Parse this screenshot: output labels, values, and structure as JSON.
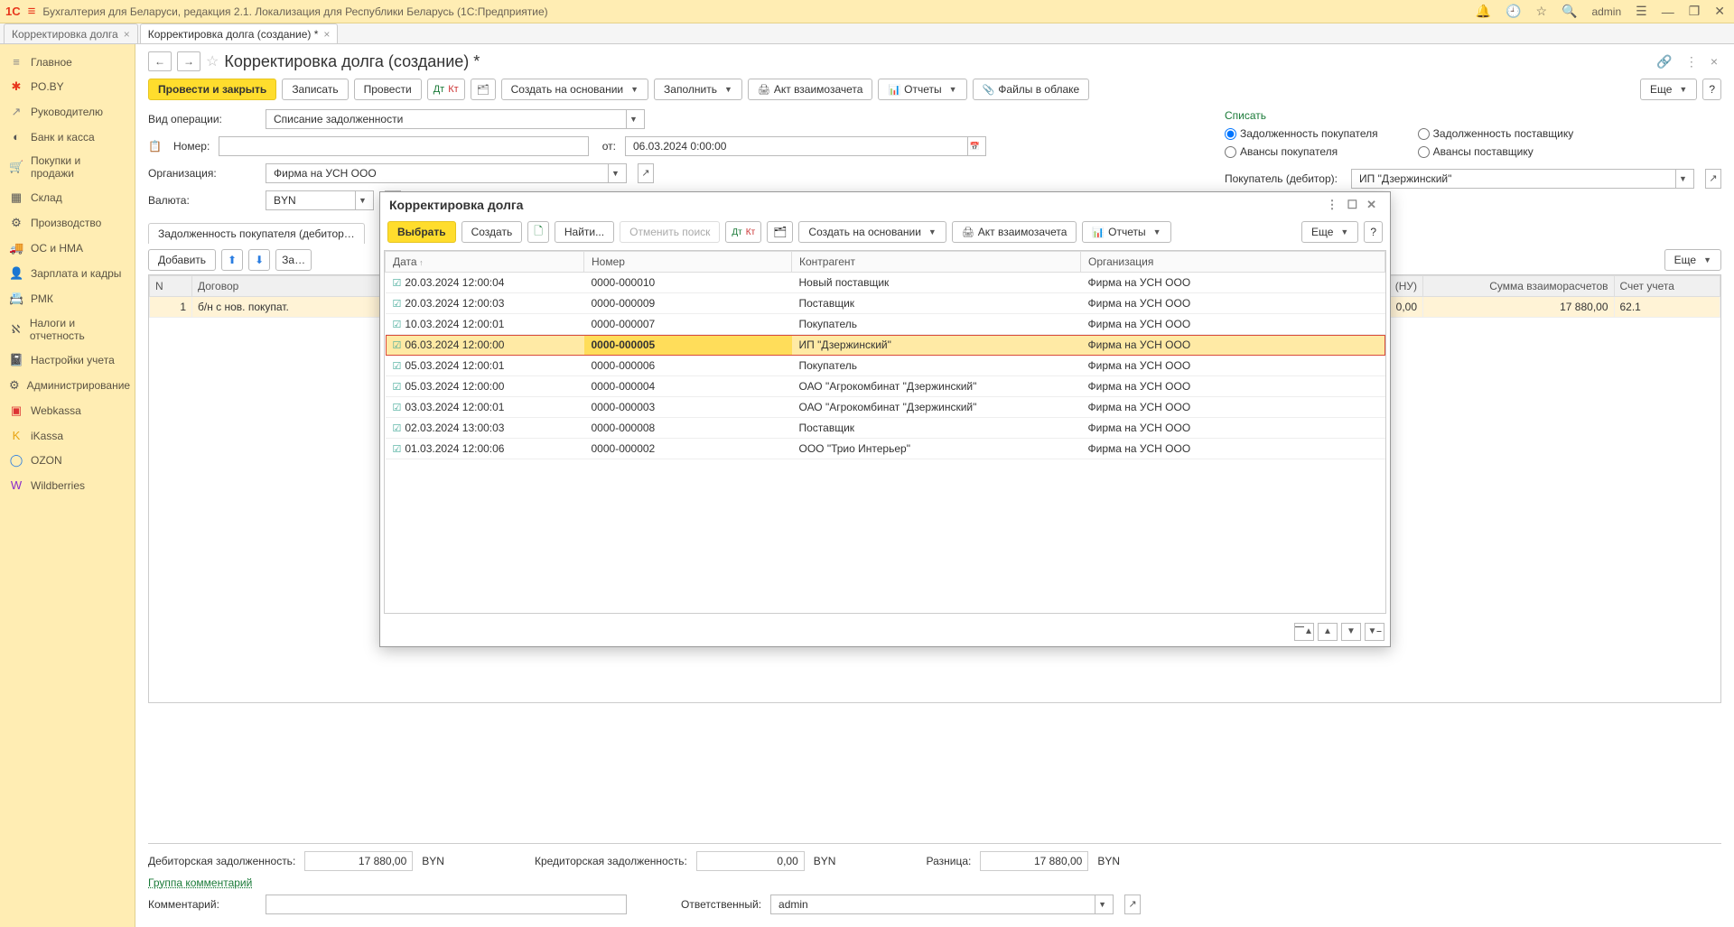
{
  "app": {
    "logo": "1C",
    "title": "Бухгалтерия для Беларуси, редакция 2.1. Локализация для Республики Беларусь   (1С:Предприятие)",
    "user": "admin"
  },
  "tabs": [
    {
      "label": "Корректировка долга",
      "active": false
    },
    {
      "label": "Корректировка долга (создание) *",
      "active": true
    }
  ],
  "sidebar": [
    {
      "icon": "≡",
      "label": "Главное",
      "color": "#888"
    },
    {
      "icon": "✱",
      "label": "PO.BY",
      "color": "#e8371c"
    },
    {
      "icon": "↗",
      "label": "Руководителю",
      "color": "#888"
    },
    {
      "icon": "◐",
      "label": "Банк и касса",
      "color": "#555"
    },
    {
      "icon": "🛒",
      "label": "Покупки и продажи",
      "color": "#555"
    },
    {
      "icon": "▦",
      "label": "Склад",
      "color": "#555"
    },
    {
      "icon": "⚙",
      "label": "Производство",
      "color": "#555"
    },
    {
      "icon": "🚚",
      "label": "ОС и НМА",
      "color": "#555"
    },
    {
      "icon": "👤",
      "label": "Зарплата и кадры",
      "color": "#555"
    },
    {
      "icon": "📇",
      "label": "РМК",
      "color": "#555"
    },
    {
      "icon": "ℵ",
      "label": "Налоги и отчетность",
      "color": "#555"
    },
    {
      "icon": "📓",
      "label": "Настройки учета",
      "color": "#555"
    },
    {
      "icon": "⚙",
      "label": "Администрирование",
      "color": "#555"
    },
    {
      "icon": "▣",
      "label": "Webkassa",
      "color": "#d33"
    },
    {
      "icon": "K",
      "label": "iKassa",
      "color": "#e8a412"
    },
    {
      "icon": "◯",
      "label": "OZON",
      "color": "#2a7de1"
    },
    {
      "icon": "W",
      "label": "Wildberries",
      "color": "#8a2bca"
    }
  ],
  "form": {
    "title": "Корректировка долга (создание) *",
    "toolbar": {
      "postClose": "Провести и закрыть",
      "write": "Записать",
      "post": "Провести",
      "createBased": "Создать на основании",
      "fill": "Заполнить",
      "act": "Акт взаимозачета",
      "reports": "Отчеты",
      "files": "Файлы в облаке",
      "more": "Еще"
    },
    "fields": {
      "opTypeLbl": "Вид операции:",
      "opType": "Списание задолженности",
      "numberLbl": "Номер:",
      "number": "",
      "fromLbl": "от:",
      "from": "06.03.2024  0:00:00",
      "orgLbl": "Организация:",
      "org": "Фирма на УСН ООО",
      "currencyLbl": "Валюта:",
      "currency": "BYN",
      "writeOffTitle": "Списать",
      "radios": {
        "r1": "Задолженность покупателя",
        "r2": "Задолженность поставщику",
        "r3": "Авансы покупателя",
        "r4": "Авансы поставщику"
      },
      "buyerLbl": "Покупатель (дебитор):",
      "buyer": "ИП \"Дзержинский\""
    },
    "sectionTab": "Задолженность покупателя (дебитор…",
    "detailToolbar": {
      "add": "Добавить",
      "more": "Еще"
    },
    "detailCols": {
      "n": "N",
      "contract": "Договор",
      "nu": "(НУ)",
      "sum": "Сумма взаиморасчетов",
      "account": "Счет учета"
    },
    "detailRow": {
      "n": "1",
      "contract": "б/н с нов. покупат.",
      "nu": "0,00",
      "sum": "17 880,00",
      "account": "62.1"
    },
    "summary": {
      "debLbl": "Дебиторская задолженность:",
      "deb": "17 880,00",
      "credLbl": "Кредиторская задолженность:",
      "cred": "0,00",
      "diffLbl": "Разница:",
      "diff": "17 880,00",
      "cur": "BYN",
      "groupComments": "Группа комментарий",
      "commentLbl": "Комментарий:",
      "comment": "",
      "respLbl": "Ответственный:",
      "resp": "admin"
    }
  },
  "dialog": {
    "title": "Корректировка долга",
    "toolbar": {
      "select": "Выбрать",
      "create": "Создать",
      "find": "Найти...",
      "cancelFind": "Отменить поиск",
      "createBased": "Создать на основании",
      "act": "Акт взаимозачета",
      "reports": "Отчеты",
      "more": "Еще"
    },
    "cols": {
      "date": "Дата",
      "number": "Номер",
      "counterparty": "Контрагент",
      "org": "Организация"
    },
    "rows": [
      {
        "date": "20.03.2024 12:00:04",
        "number": "0000-000010",
        "cp": "Новый поставщик",
        "org": "Фирма на УСН ООО",
        "sel": false
      },
      {
        "date": "20.03.2024 12:00:03",
        "number": "0000-000009",
        "cp": "Поставщик",
        "org": "Фирма на УСН ООО",
        "sel": false
      },
      {
        "date": "10.03.2024 12:00:01",
        "number": "0000-000007",
        "cp": "Покупатель",
        "org": "Фирма на УСН ООО",
        "sel": false
      },
      {
        "date": "06.03.2024 12:00:00",
        "number": "0000-000005",
        "cp": "ИП \"Дзержинский\"",
        "org": "Фирма на УСН ООО",
        "sel": true
      },
      {
        "date": "05.03.2024 12:00:01",
        "number": "0000-000006",
        "cp": "Покупатель",
        "org": "Фирма на УСН ООО",
        "sel": false
      },
      {
        "date": "05.03.2024 12:00:00",
        "number": "0000-000004",
        "cp": "ОАО \"Агрокомбинат \"Дзержинский\"",
        "org": "Фирма на УСН ООО",
        "sel": false
      },
      {
        "date": "03.03.2024 12:00:01",
        "number": "0000-000003",
        "cp": "ОАО \"Агрокомбинат \"Дзержинский\"",
        "org": "Фирма на УСН ООО",
        "sel": false
      },
      {
        "date": "02.03.2024 13:00:03",
        "number": "0000-000008",
        "cp": "Поставщик",
        "org": "Фирма на УСН ООО",
        "sel": false
      },
      {
        "date": "01.03.2024 12:00:06",
        "number": "0000-000002",
        "cp": "ООО \"Трио Интерьер\"",
        "org": "Фирма на УСН ООО",
        "sel": false
      }
    ]
  }
}
